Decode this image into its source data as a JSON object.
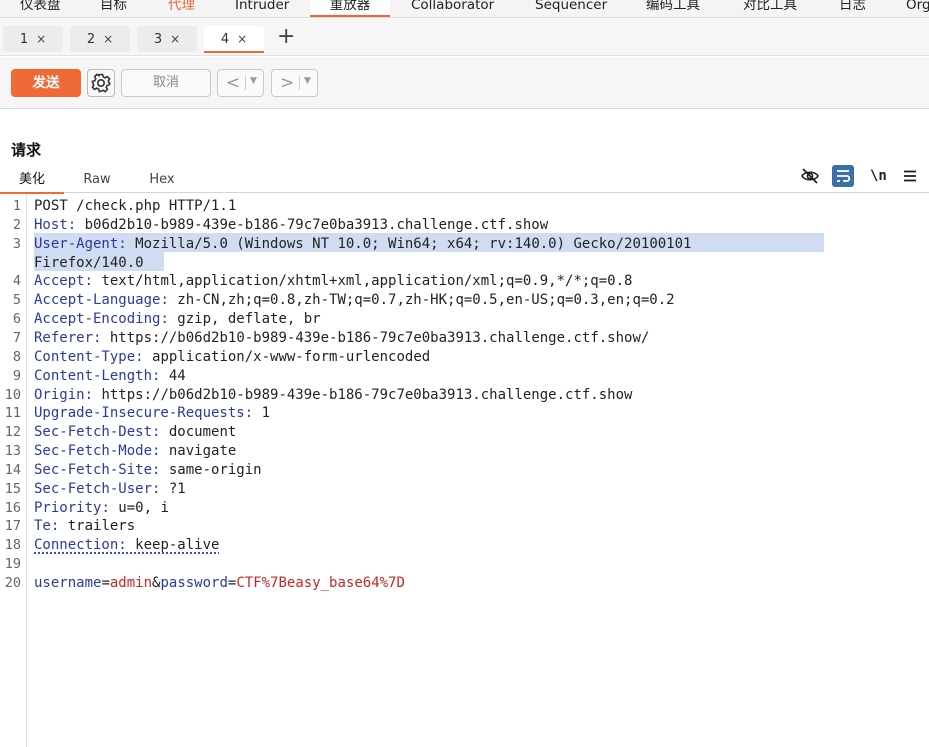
{
  "menu": {
    "items": [
      {
        "label": "仪表盘",
        "style": "normal"
      },
      {
        "label": "目标",
        "style": "normal"
      },
      {
        "label": "代理",
        "style": "orange"
      },
      {
        "label": "Intruder",
        "style": "normal"
      },
      {
        "label": "重放器",
        "style": "active"
      },
      {
        "label": "Collaborator",
        "style": "normal"
      },
      {
        "label": "Sequencer",
        "style": "normal"
      },
      {
        "label": "编码工具",
        "style": "normal"
      },
      {
        "label": "对比工具",
        "style": "normal"
      },
      {
        "label": "日志",
        "style": "normal"
      },
      {
        "label": "Org",
        "style": "normal"
      }
    ]
  },
  "tabs": [
    {
      "label": "1",
      "close": "×"
    },
    {
      "label": "2",
      "close": "×"
    },
    {
      "label": "3",
      "close": "×"
    },
    {
      "label": "4",
      "close": "×"
    }
  ],
  "new_tab_label": "+",
  "toolbar": {
    "send_label": "发送",
    "cancel_label": "取消",
    "prev_glyph": "<",
    "next_glyph": ">",
    "dropdown_glyph": "▼"
  },
  "request": {
    "title": "请求",
    "subtabs": [
      "美化",
      "Raw",
      "Hex"
    ],
    "wrap_label": "\\n"
  },
  "editor": {
    "lines": [
      {
        "n": "1",
        "header": "",
        "value": "POST /check.php HTTP/1.1"
      },
      {
        "n": "2",
        "header": "Host",
        "value": " b06d2b10-b989-439e-b186-79c7e0ba3913.challenge.ctf.show"
      },
      {
        "n": "3",
        "header": "User-Agent",
        "value": " Mozilla/5.0 (Windows NT 10.0; Win64; x64; rv:140.0) Gecko/20100101"
      },
      {
        "n": "",
        "header": "",
        "value": "Firefox/140.0"
      },
      {
        "n": "4",
        "header": "Accept",
        "value": " text/html,application/xhtml+xml,application/xml;q=0.9,*/*;q=0.8"
      },
      {
        "n": "5",
        "header": "Accept-Language",
        "value": " zh-CN,zh;q=0.8,zh-TW;q=0.7,zh-HK;q=0.5,en-US;q=0.3,en;q=0.2"
      },
      {
        "n": "6",
        "header": "Accept-Encoding",
        "value": " gzip, deflate, br"
      },
      {
        "n": "7",
        "header": "Referer",
        "value": " https://b06d2b10-b989-439e-b186-79c7e0ba3913.challenge.ctf.show/"
      },
      {
        "n": "8",
        "header": "Content-Type",
        "value": " application/x-www-form-urlencoded"
      },
      {
        "n": "9",
        "header": "Content-Length",
        "value": " 44"
      },
      {
        "n": "10",
        "header": "Origin",
        "value": " https://b06d2b10-b989-439e-b186-79c7e0ba3913.challenge.ctf.show"
      },
      {
        "n": "11",
        "header": "Upgrade-Insecure-Requests",
        "value": " 1"
      },
      {
        "n": "12",
        "header": "Sec-Fetch-Dest",
        "value": " document"
      },
      {
        "n": "13",
        "header": "Sec-Fetch-Mode",
        "value": " navigate"
      },
      {
        "n": "14",
        "header": "Sec-Fetch-Site",
        "value": " same-origin"
      },
      {
        "n": "15",
        "header": "Sec-Fetch-User",
        "value": " ?1"
      },
      {
        "n": "16",
        "header": "Priority",
        "value": " u=0, i"
      },
      {
        "n": "17",
        "header": "Te",
        "value": " trailers"
      },
      {
        "n": "18",
        "header": "Connection",
        "value": " keep-alive"
      },
      {
        "n": "19",
        "header": "",
        "value": ""
      }
    ],
    "body_line": {
      "n": "20",
      "params": [
        {
          "key": "username",
          "eq": "=",
          "value": "admin"
        },
        {
          "key": "password",
          "eq": "=",
          "value": "CTF%7Beasy_base64%7D"
        }
      ],
      "sep": "&"
    }
  },
  "colors": {
    "accent": "#ec6a3a",
    "send_bg": "#f06a35",
    "header_name": "#2a39a4",
    "param_value": "#c62828",
    "selection": "#cfdcf2"
  }
}
